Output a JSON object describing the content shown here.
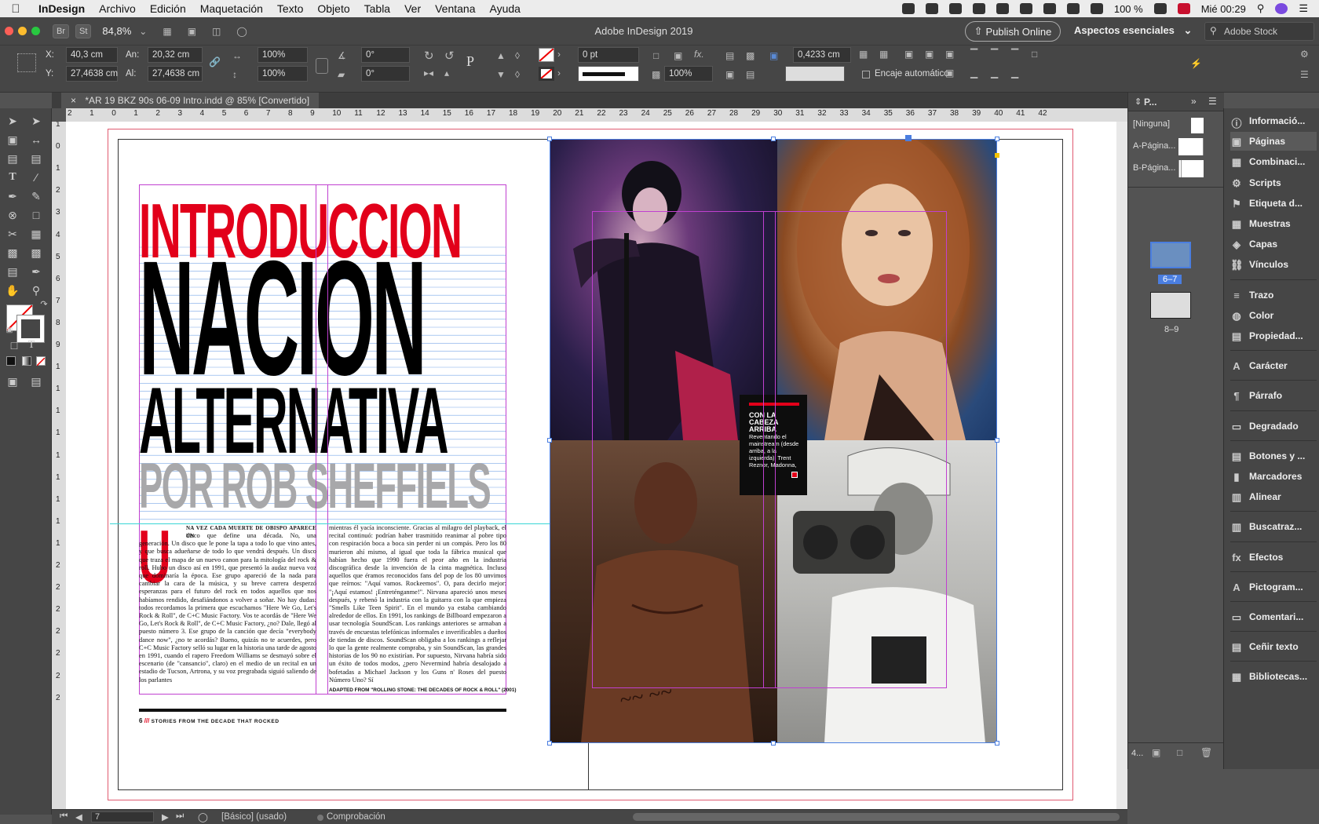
{
  "menubar": {
    "app_name": "InDesign",
    "items": [
      "Archivo",
      "Edición",
      "Maquetación",
      "Texto",
      "Objeto",
      "Tabla",
      "Ver",
      "Ventana",
      "Ayuda"
    ],
    "battery": "100 %",
    "clock": "Mié 00:29"
  },
  "appbar": {
    "zoom": "84,8%",
    "br": "Br",
    "st": "St",
    "title": "Adobe InDesign 2019",
    "publish": "Publish Online",
    "workspace": "Aspectos esenciales",
    "search_placeholder": "Adobe Stock"
  },
  "control": {
    "x_label": "X:",
    "x_value": "40,3 cm",
    "y_label": "Y:",
    "y_value": "27,4638 cm",
    "w_label": "An:",
    "w_value": "20,32 cm",
    "h_label": "Al:",
    "h_value": "27,4638 cm",
    "scale_x": "100%",
    "scale_y": "100%",
    "angle": "0°",
    "shear": "0°",
    "stroke_weight": "0 pt",
    "opacity": "100%",
    "offset": "0,4233 cm",
    "autofit": "Encaje automático"
  },
  "document": {
    "tab_title": "*AR 19 BKZ 90s 06-09 Intro.indd @ 85% [Convertido]",
    "ruler_h": [
      "2",
      "1",
      "0",
      "1",
      "2",
      "3",
      "4",
      "5",
      "6",
      "7",
      "8",
      "9",
      "10",
      "11",
      "12",
      "13",
      "14",
      "15",
      "16",
      "17",
      "18",
      "19",
      "20",
      "21",
      "22",
      "23",
      "24",
      "25",
      "26",
      "27",
      "28",
      "29",
      "30",
      "31",
      "32",
      "33",
      "34",
      "35",
      "36",
      "37",
      "38",
      "39",
      "40",
      "41",
      "42"
    ],
    "ruler_v": [
      "1",
      "0",
      "1",
      "2",
      "3",
      "4",
      "5",
      "6",
      "7",
      "8",
      "9",
      "1",
      "1",
      "1",
      "1",
      "1",
      "1",
      "1",
      "1",
      "1",
      "2",
      "2",
      "2",
      "2",
      "2",
      "2",
      "2"
    ],
    "headline1": "INTRODUCCION",
    "headline2": "NACION",
    "headline3": "ALTERNATIVA",
    "byline": "POR ROB SHEFFIELS",
    "dropcap": "U",
    "col1_lead": "NA VEZ CADA MUERTE DE OBISPO APARECE UN",
    "col1": "disco que define una década. No, una generación. Un disco que le pone la tapa a todo lo que vino antes, y que busca adueñarse de todo lo que vendrá después. Un disco que traza el mapa de un nuevo canon para la mitología del rock & roll. Hubo un disco así en 1991, que presentó la audaz nueva voz que dominaría la época. Ese grupo apareció de la nada para cambiar la cara de la música, y su breve carrera desperzó esperanzas para el futuro del rock en todos aquellos que nos habíamos rendido, desafiándonos a volver a soñar. No hay dudas: todos recordamos la primera que escuchamos \"Here We Go, Let's Rock & Roll\", de C+C Music Factory. Vos te acordás de \"Here We Go, Let's Rock & Roll\", de C+C Music Factory, ¿no? Dale, llegó al puesto número 3. Ese grupo de la canción que decía \"everybody dance now\", ¿no te acordás? Bueno, quizás no te acuerdes, pero C+C Music Factory selló su lugar en la historia una tarde de agosto en 1991, cuando el rapero Freedom Williams se desmayó sobre el escenario (de \"cansancio\", claro) en el medio de un recital en un estadio de Tucson, Artrona, y su voz pregrabada siguió saliendo de los parlantes",
    "col2": "mientras él yacía inconsciente. Gracias al milagro del playback, el recital continuó: podrían haber trasmitido reanimar al pobre tipo con respiración boca a boca sin perder ni un compás. Pero los 80 murieron ahí mismo, al igual que toda la fábrica musical que habían hecho que 1990 fuera el peor año en la industria discográfica desde la invención de la cinta magnética. Incluso aquellos que éramos reconocidos fans del pop de los 80 unvimos que reírnos: \"Aquí vamos. Rockeemos\". O, para decirlo mejor: \"¡Aquí estamos! ¡Entreténganme!\". Nirvana apareció unos meses después, y rebenó la industria con la guitarra con la que empieza \"Smells Like Teen Spirit\". En el mundo ya estaba cambiando alrededor de ellos. En 1991, los rankings de Billboard empezaron a usar tecnología SoundScan. Los rankings anteriores se armaban a través de encuestas telefónicas informales e inverificables a dueños de tiendas de discos. SoundScan obligaba a los rankings a reflejar lo que la gente realmente compraba, y sin SoundScan, las grandes historias de los 90 no existirían. Por supuesto, Nirvana habría sido un éxito de todos modos, ¿pero Nevermind habría desalojado a bofetadas a Michael Jackson y los Guns n' Roses del puesto Número Uno? Sí",
    "credit": "ADAPTED FROM \"ROLLING STONE: THE DECADES OF ROCK & ROLL\" (2001)",
    "folio_num": "6",
    "folio_marks": "///",
    "folio_text": "STORIES FROM THE DECADE THAT ROCKED",
    "caption_title": "CON LA CABEZA ARRIBA",
    "caption_body": "Reventando el mainstream (desde arriba, a la izquierda): Trent Reznor, Madonna,"
  },
  "pages_panel": {
    "tab": "P...",
    "masters": [
      "[Ninguna]",
      "A-Página...",
      "B-Página..."
    ],
    "spread1_label": "6–7",
    "spread2_label": "8–9",
    "footer": "4..."
  },
  "side_panels": [
    "Informació...",
    "Páginas",
    "Combinaci...",
    "Scripts",
    "Etiqueta d...",
    "Muestras",
    "Capas",
    "Vínculos",
    "Trazo",
    "Color",
    "Propiedad...",
    "Carácter",
    "Párrafo",
    "Degradado",
    "Botones y ...",
    "Marcadores",
    "Alinear",
    "Buscatraz...",
    "Efectos",
    "Pictogram...",
    "Comentari...",
    "Ceñir texto",
    "Bibliotecas..."
  ],
  "status": {
    "page": "7",
    "master": "[Básico] (usado)",
    "preflight": "Comprobación"
  },
  "colors": {
    "headline_red": "#e2001a",
    "byline_gray": "#a8a8aa",
    "guide_magenta": "#c040d0",
    "baseline_blue": "#7aa8e8"
  }
}
